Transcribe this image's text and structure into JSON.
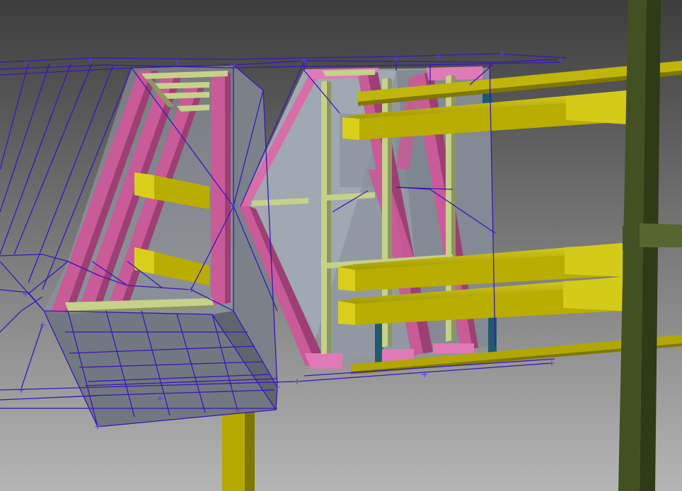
{
  "viewport": {
    "title": "",
    "background_top": "#3d3d3d",
    "background_bottom": "#b5b5b5"
  },
  "colors": {
    "wireframe": "#3a16b8",
    "wireframe_node": "#5a3ae0",
    "concrete_face": "#8c929b",
    "concrete_face_light": "#9aa1ab",
    "concrete_face_dark": "#6f757e",
    "pink_member": "#c85b98",
    "pink_member_light": "#e07ab6",
    "pale_member": "#c6d18a",
    "pale_member_dark": "#8d9560",
    "yellow_beam": "#b8ad00",
    "yellow_beam_light": "#d9cf1a",
    "yellow_beam_dark": "#7e7800",
    "olive_column": "#435022",
    "olive_column_dark": "#2f3a16",
    "olive_column_light": "#566631",
    "teal_post": "#1f5c6b",
    "yellow_column_below": "#b3a900"
  },
  "scene_objects": [
    {
      "name": "wireframe-slab-left",
      "kind": "wireframe"
    },
    {
      "name": "wireframe-slab-top",
      "kind": "wireframe"
    },
    {
      "name": "concrete-block-left",
      "kind": "solid"
    },
    {
      "name": "concrete-block-center",
      "kind": "solid"
    },
    {
      "name": "pink-bracing",
      "kind": "member"
    },
    {
      "name": "pale-frame",
      "kind": "member"
    },
    {
      "name": "yellow-beams",
      "kind": "member"
    },
    {
      "name": "olive-column-right",
      "kind": "member"
    },
    {
      "name": "yellow-column-below",
      "kind": "member"
    },
    {
      "name": "teal-posts",
      "kind": "member"
    }
  ]
}
